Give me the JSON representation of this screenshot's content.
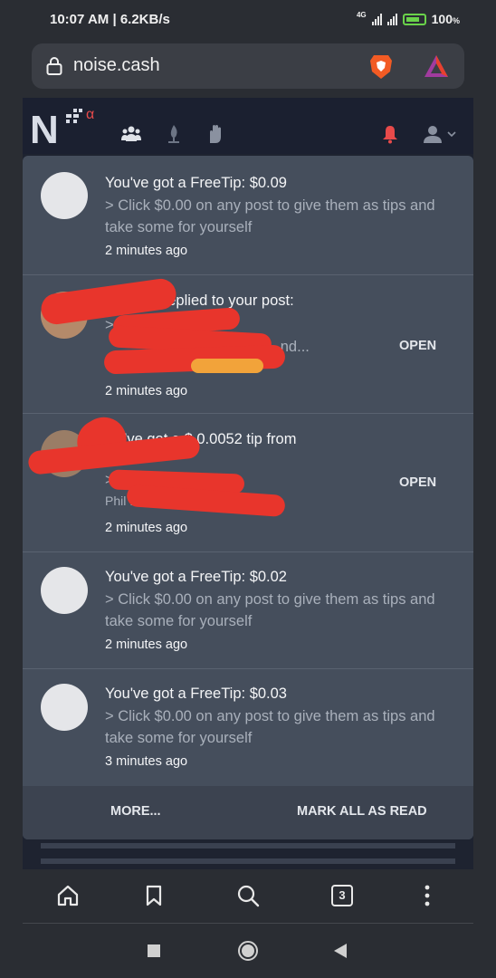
{
  "status_bar": {
    "time": "10:07 AM | 6.2KB/s",
    "network": "4G",
    "battery": "100"
  },
  "browser": {
    "url": "noise.cash",
    "tab_count": "3"
  },
  "site": {
    "logo_text": "N",
    "logo_badge": "α"
  },
  "notifications": [
    {
      "title": "You've got a FreeTip: $0.09",
      "body": "> Click $0.00 on any post to give them as tips and take some for yourself",
      "time": "2 minutes ago",
      "has_open": false
    },
    {
      "title": "6 replied to your post:",
      "body_line1": ">",
      "body_line2": "...nd...",
      "time": "2 minutes ago",
      "open_label": "OPEN"
    },
    {
      "title": "u've got a $ 0.0052 tip from",
      "body_line1": ">",
      "body_line2": "Phil                      ...b and...",
      "time": "2 minutes ago",
      "open_label": "OPEN"
    },
    {
      "title": "You've got a FreeTip: $0.02",
      "body": "> Click $0.00 on any post to give them as tips and take some for yourself",
      "time": "2 minutes ago"
    },
    {
      "title": "You've got a FreeTip: $0.03",
      "body": "> Click $0.00 on any post to give them as tips and take some for yourself",
      "time": "3 minutes ago"
    }
  ],
  "footer": {
    "more_label": "MORE...",
    "mark_read_label": "MARK ALL AS READ"
  },
  "colors": {
    "panel": "#454e5c",
    "accent_red": "#e84a4a",
    "redaction": "#e8352c"
  }
}
